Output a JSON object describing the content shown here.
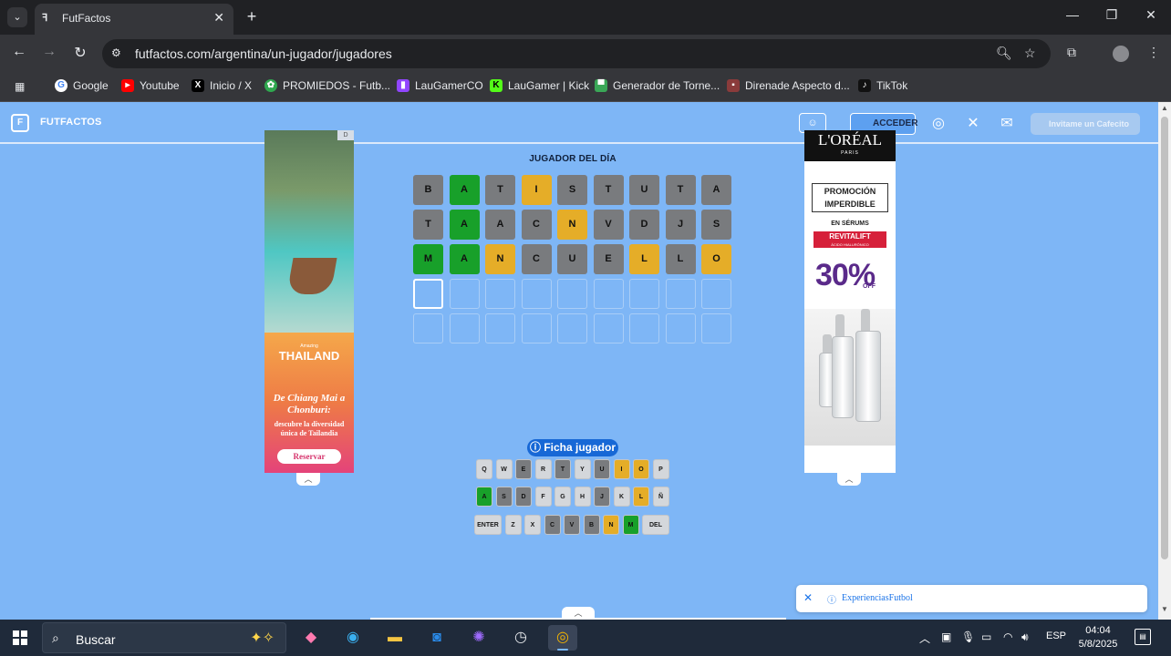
{
  "browser": {
    "tab_title": "FutFactos",
    "url": "futfactos.com/argentina/un-jugador/jugadores",
    "bookmarks": [
      {
        "label": "Google",
        "color": "#4285f4",
        "icon": "google-icon"
      },
      {
        "label": "Youtube",
        "color": "#ff0000",
        "icon": "youtube-icon"
      },
      {
        "label": "Inicio / X",
        "color": "#000000",
        "icon": "x-icon"
      },
      {
        "label": "PROMIEDOS - Futb...",
        "color": "#2fa84f",
        "icon": "promiedos-icon"
      },
      {
        "label": "LauGamerCO",
        "color": "#9146ff",
        "icon": "twitch-icon"
      },
      {
        "label": "LauGamer | Kick",
        "color": "#53fc18",
        "icon": "kick-icon"
      },
      {
        "label": "Generador de Torne...",
        "color": "#3aa757",
        "icon": "trophy-icon"
      },
      {
        "label": "Direnade Aspecto d...",
        "color": "#8a3b3b",
        "icon": "image-icon"
      },
      {
        "label": "TikTok",
        "color": "#111111",
        "icon": "tiktok-icon"
      }
    ]
  },
  "site": {
    "logo_text": "FUTFACTOS",
    "acceder_label": "ACCEDER",
    "cafecito_label": "Invitame un Cafecito"
  },
  "ads": {
    "left": {
      "badge": "D",
      "brand": "THAILAND",
      "tagline": "Amazing",
      "script": "De Chiang Mai a Chonburi:",
      "desc": "descubre la diversidad única de Tailandia",
      "cta": "Reservar"
    },
    "right": {
      "brand": "L'ORÉAL",
      "paris": "PARIS",
      "promo": "PROMOCIÓN IMPERDIBLE",
      "serums": "EN SÉRUMS",
      "revital": "REVITALIFT",
      "revital_sub": "ÁCIDO HIALURÓNICO",
      "percent": "30%",
      "off": "OFF"
    }
  },
  "game": {
    "title": "JUGADOR DEL DÍA",
    "rows": [
      [
        {
          "l": "B",
          "s": "gray"
        },
        {
          "l": "A",
          "s": "green"
        },
        {
          "l": "T",
          "s": "gray"
        },
        {
          "l": "I",
          "s": "yellow"
        },
        {
          "l": "S",
          "s": "gray"
        },
        {
          "l": "T",
          "s": "gray"
        },
        {
          "l": "U",
          "s": "gray"
        },
        {
          "l": "T",
          "s": "gray"
        },
        {
          "l": "A",
          "s": "gray"
        }
      ],
      [
        {
          "l": "T",
          "s": "gray"
        },
        {
          "l": "A",
          "s": "green"
        },
        {
          "l": "A",
          "s": "gray"
        },
        {
          "l": "C",
          "s": "gray"
        },
        {
          "l": "N",
          "s": "yellow"
        },
        {
          "l": "V",
          "s": "gray"
        },
        {
          "l": "D",
          "s": "gray"
        },
        {
          "l": "J",
          "s": "gray"
        },
        {
          "l": "S",
          "s": "gray"
        }
      ],
      [
        {
          "l": "M",
          "s": "green"
        },
        {
          "l": "A",
          "s": "green"
        },
        {
          "l": "N",
          "s": "yellow"
        },
        {
          "l": "C",
          "s": "gray"
        },
        {
          "l": "U",
          "s": "gray"
        },
        {
          "l": "E",
          "s": "gray"
        },
        {
          "l": "L",
          "s": "yellow"
        },
        {
          "l": "L",
          "s": "gray"
        },
        {
          "l": "O",
          "s": "yellow"
        }
      ],
      [
        {
          "l": "",
          "s": "empty active"
        },
        {
          "l": "",
          "s": "empty"
        },
        {
          "l": "",
          "s": "empty"
        },
        {
          "l": "",
          "s": "empty"
        },
        {
          "l": "",
          "s": "empty"
        },
        {
          "l": "",
          "s": "empty"
        },
        {
          "l": "",
          "s": "empty"
        },
        {
          "l": "",
          "s": "empty"
        },
        {
          "l": "",
          "s": "empty"
        }
      ],
      [
        {
          "l": "",
          "s": "empty"
        },
        {
          "l": "",
          "s": "empty"
        },
        {
          "l": "",
          "s": "empty"
        },
        {
          "l": "",
          "s": "empty"
        },
        {
          "l": "",
          "s": "empty"
        },
        {
          "l": "",
          "s": "empty"
        },
        {
          "l": "",
          "s": "empty"
        },
        {
          "l": "",
          "s": "empty"
        },
        {
          "l": "",
          "s": "empty"
        }
      ]
    ],
    "keyboard": [
      [
        {
          "k": "Q",
          "s": "light"
        },
        {
          "k": "W",
          "s": "light"
        },
        {
          "k": "E",
          "s": "gray"
        },
        {
          "k": "R",
          "s": "light"
        },
        {
          "k": "T",
          "s": "gray"
        },
        {
          "k": "Y",
          "s": "light"
        },
        {
          "k": "U",
          "s": "gray"
        },
        {
          "k": "I",
          "s": "yellow"
        },
        {
          "k": "O",
          "s": "yellow"
        },
        {
          "k": "P",
          "s": "light"
        }
      ],
      [
        {
          "k": "A",
          "s": "green"
        },
        {
          "k": "S",
          "s": "gray"
        },
        {
          "k": "D",
          "s": "gray"
        },
        {
          "k": "F",
          "s": "light"
        },
        {
          "k": "G",
          "s": "light"
        },
        {
          "k": "H",
          "s": "light"
        },
        {
          "k": "J",
          "s": "gray"
        },
        {
          "k": "K",
          "s": "light"
        },
        {
          "k": "L",
          "s": "yellow"
        },
        {
          "k": "Ñ",
          "s": "light"
        }
      ],
      [
        {
          "k": "ENTER",
          "s": "light",
          "w": "wide"
        },
        {
          "k": "Z",
          "s": "light"
        },
        {
          "k": "X",
          "s": "light"
        },
        {
          "k": "C",
          "s": "gray"
        },
        {
          "k": "V",
          "s": "gray"
        },
        {
          "k": "B",
          "s": "gray"
        },
        {
          "k": "N",
          "s": "yellow"
        },
        {
          "k": "M",
          "s": "green"
        },
        {
          "k": "DEL",
          "s": "light",
          "w": "wide"
        }
      ]
    ],
    "ficha_label": "Ficha jugador"
  },
  "notification": {
    "text": "ExperienciasFutbol"
  },
  "taskbar": {
    "search_placeholder": "Buscar",
    "lang": "ESP",
    "time": "04:04",
    "date": "5/8/2025"
  }
}
